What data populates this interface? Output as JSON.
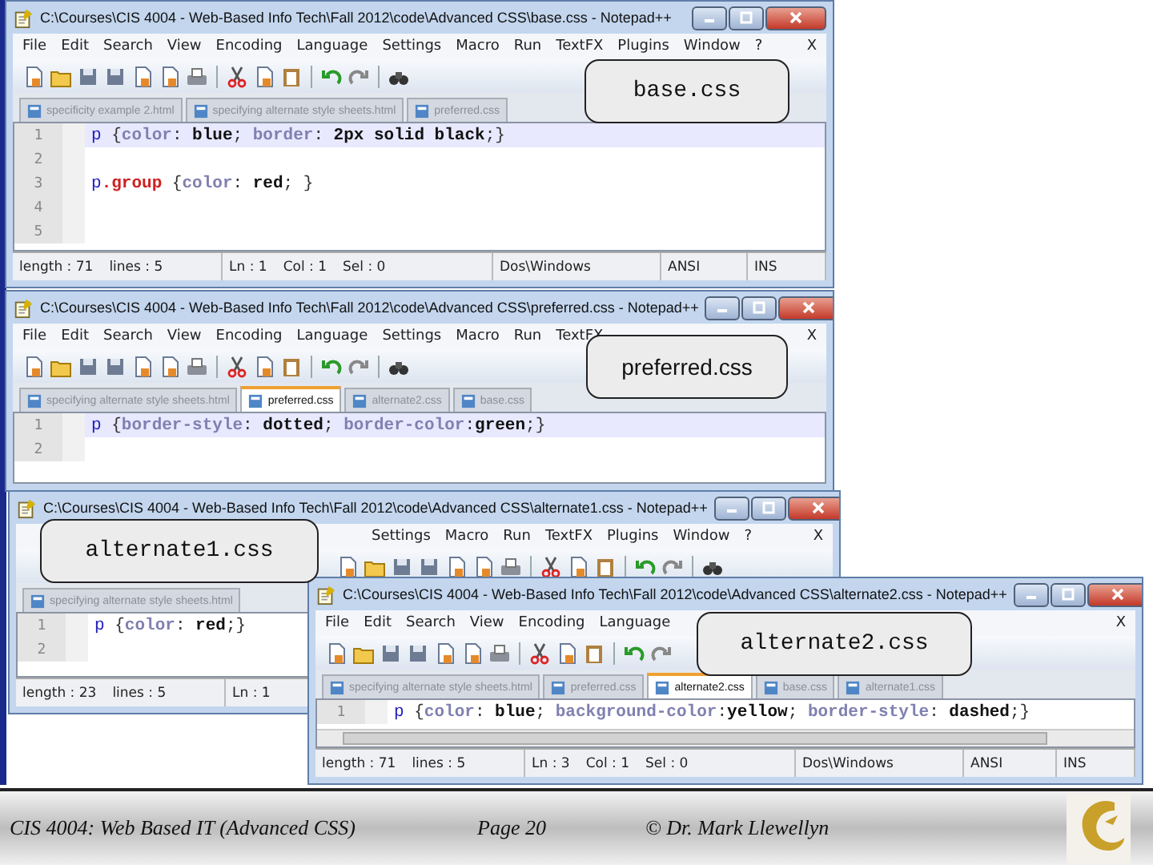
{
  "windows": [
    {
      "title": "C:\\Courses\\CIS 4004 - Web-Based Info Tech\\Fall 2012\\code\\Advanced CSS\\base.css - Notepad++",
      "menu": [
        "File",
        "Edit",
        "Search",
        "View",
        "Encoding",
        "Language",
        "Settings",
        "Macro",
        "Run",
        "TextFX",
        "Plugins",
        "Window",
        "?"
      ],
      "menu_close": "X",
      "tabs": [
        {
          "label": "specificity example 2.html",
          "selected": false
        },
        {
          "label": "specifying alternate style sheets.html",
          "selected": false
        },
        {
          "label": "preferred.css",
          "selected": false
        }
      ],
      "lines": [
        {
          "number": "1",
          "current": true,
          "tokens": [
            {
              "text": "p",
              "kind": "selector"
            },
            {
              "text": " {",
              "kind": "punct"
            },
            {
              "text": "color",
              "kind": "property"
            },
            {
              "text": ": ",
              "kind": "punct"
            },
            {
              "text": "blue",
              "kind": "value"
            },
            {
              "text": "; ",
              "kind": "punct"
            },
            {
              "text": "border",
              "kind": "property"
            },
            {
              "text": ": ",
              "kind": "punct"
            },
            {
              "text": "2px solid black",
              "kind": "value"
            },
            {
              "text": ";}",
              "kind": "punct"
            }
          ]
        },
        {
          "number": "2",
          "current": false
        },
        {
          "number": "3",
          "current": false,
          "tokens": [
            {
              "text": "p",
              "kind": "selector"
            },
            {
              "text": ".group",
              "kind": "class"
            },
            {
              "text": " {",
              "kind": "punct"
            },
            {
              "text": "color",
              "kind": "property"
            },
            {
              "text": ": ",
              "kind": "punct"
            },
            {
              "text": "red",
              "kind": "value"
            },
            {
              "text": "; }",
              "kind": "punct"
            }
          ]
        },
        {
          "number": "4",
          "current": false
        },
        {
          "number": "5",
          "current": false
        }
      ],
      "status": [
        [
          "length : 71",
          "lines : 5"
        ],
        [
          "Ln : 1",
          "Col : 1",
          "Sel : 0"
        ],
        [
          "Dos\\Windows"
        ],
        [
          "ANSI"
        ],
        [
          "INS"
        ]
      ]
    },
    {
      "title": "C:\\Courses\\CIS 4004 - Web-Based Info Tech\\Fall 2012\\code\\Advanced CSS\\preferred.css - Notepad++",
      "menu": [
        "File",
        "Edit",
        "Search",
        "View",
        "Encoding",
        "Language",
        "Settings",
        "Macro",
        "Run",
        "TextFX"
      ],
      "menu_close": "X",
      "tabs": [
        {
          "label": "specifying alternate style sheets.html",
          "selected": false
        },
        {
          "label": "preferred.css",
          "selected": true
        },
        {
          "label": "alternate2.css",
          "selected": false
        },
        {
          "label": "base.css",
          "selected": false
        }
      ],
      "lines": [
        {
          "number": "1",
          "current": true,
          "tokens": [
            {
              "text": "p",
              "kind": "selector"
            },
            {
              "text": " {",
              "kind": "punct"
            },
            {
              "text": "border-style",
              "kind": "property"
            },
            {
              "text": ": ",
              "kind": "punct"
            },
            {
              "text": "dotted",
              "kind": "value"
            },
            {
              "text": "; ",
              "kind": "punct"
            },
            {
              "text": "border-color",
              "kind": "property"
            },
            {
              "text": ":",
              "kind": "punct"
            },
            {
              "text": "green",
              "kind": "value"
            },
            {
              "text": ";}",
              "kind": "punct"
            }
          ]
        },
        {
          "number": "2",
          "current": false
        }
      ]
    },
    {
      "title": "C:\\Courses\\CIS 4004 - Web-Based Info Tech\\Fall 2012\\code\\Advanced CSS\\alternate1.css - Notepad++",
      "menu": [
        "Settings",
        "Macro",
        "Run",
        "TextFX",
        "Plugins",
        "Window",
        "?"
      ],
      "menu_close": "X",
      "tabs": [
        {
          "label": "specifying alternate style sheets.html",
          "selected": false
        }
      ],
      "lines": [
        {
          "number": "1",
          "current": false,
          "tokens": [
            {
              "text": "p",
              "kind": "selector"
            },
            {
              "text": " {",
              "kind": "punct"
            },
            {
              "text": "color",
              "kind": "property"
            },
            {
              "text": ": ",
              "kind": "punct"
            },
            {
              "text": "red",
              "kind": "value"
            },
            {
              "text": ";}",
              "kind": "punct"
            }
          ]
        },
        {
          "number": "2",
          "current": false
        }
      ],
      "status": [
        [
          "length : 23",
          "lines : 5"
        ],
        [
          "Ln : 1"
        ]
      ]
    },
    {
      "title": "C:\\Courses\\CIS 4004 - Web-Based Info Tech\\Fall 2012\\code\\Advanced CSS\\alternate2.css - Notepad++",
      "menu": [
        "File",
        "Edit",
        "Search",
        "View",
        "Encoding",
        "Language"
      ],
      "menu_close": "X",
      "tabs": [
        {
          "label": "specifying alternate style sheets.html",
          "selected": false
        },
        {
          "label": "preferred.css",
          "selected": false
        },
        {
          "label": "alternate2.css",
          "selected": true
        },
        {
          "label": "base.css",
          "selected": false
        },
        {
          "label": "alternate1.css",
          "selected": false
        }
      ],
      "lines": [
        {
          "number": "1",
          "current": false,
          "tokens": [
            {
              "text": "p",
              "kind": "selector"
            },
            {
              "text": " {",
              "kind": "punct"
            },
            {
              "text": "color",
              "kind": "property"
            },
            {
              "text": ": ",
              "kind": "punct"
            },
            {
              "text": "blue",
              "kind": "value"
            },
            {
              "text": "; ",
              "kind": "punct"
            },
            {
              "text": "background-color",
              "kind": "property"
            },
            {
              "text": ":",
              "kind": "punct"
            },
            {
              "text": "yellow",
              "kind": "value"
            },
            {
              "text": "; ",
              "kind": "punct"
            },
            {
              "text": "border-style",
              "kind": "property"
            },
            {
              "text": ": ",
              "kind": "punct"
            },
            {
              "text": "dashed",
              "kind": "value"
            },
            {
              "text": ";}",
              "kind": "punct"
            }
          ]
        }
      ],
      "hscroll": true,
      "status": [
        [
          "length : 71",
          "lines : 5"
        ],
        [
          "Ln : 3",
          "Col : 1",
          "Sel : 0"
        ],
        [
          "Dos\\Windows"
        ],
        [
          "ANSI"
        ],
        [
          "INS"
        ]
      ]
    }
  ],
  "callouts": [
    {
      "text": "base.css"
    },
    {
      "text": "preferred.css"
    },
    {
      "text": "alternate1.css"
    },
    {
      "text": "alternate2.css"
    }
  ],
  "footer": {
    "course": "CIS 4004: Web Based IT (Advanced CSS)",
    "page": "Page 20",
    "author": "© Dr. Mark Llewellyn"
  }
}
